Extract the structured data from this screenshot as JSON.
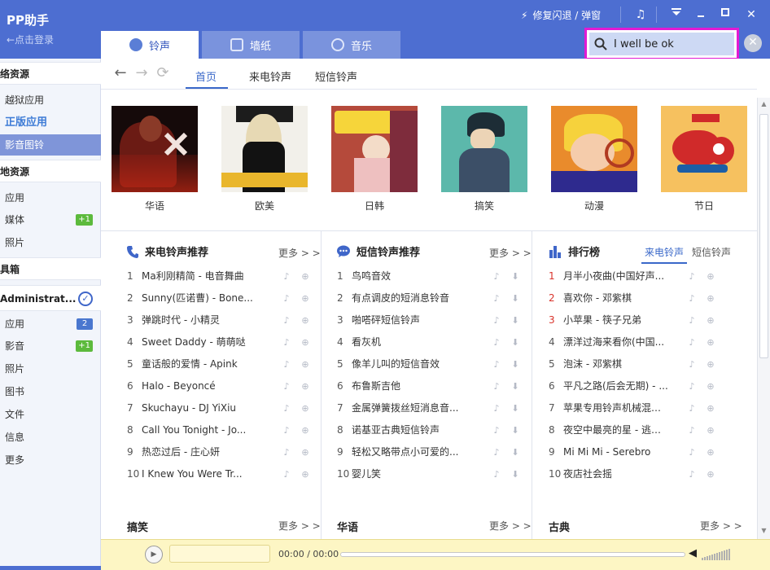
{
  "app": {
    "title": "PP助手",
    "login": "←点击登录",
    "repair": "修复闪退 / 弹窗"
  },
  "main_tabs": [
    {
      "label": "铃声",
      "active": true
    },
    {
      "label": "墙纸",
      "active": false
    },
    {
      "label": "音乐",
      "active": false
    }
  ],
  "search": {
    "value": "I well be ok"
  },
  "sidebar": {
    "groups": [
      {
        "label": "络资源"
      },
      {
        "label": "地资源"
      },
      {
        "label": "具箱"
      },
      {
        "label": "Administrat..."
      }
    ],
    "items": [
      {
        "label": "越狱应用"
      },
      {
        "label": "正版应用"
      },
      {
        "label": "影音图铃"
      },
      {
        "label": "应用"
      },
      {
        "label": "媒体",
        "badge": "+1"
      },
      {
        "label": "照片"
      },
      {
        "label": "应用",
        "badge": "2"
      },
      {
        "label": "影音",
        "badge": "+1"
      },
      {
        "label": "照片"
      },
      {
        "label": "图书"
      },
      {
        "label": "文件"
      },
      {
        "label": "信息"
      },
      {
        "label": "更多"
      }
    ]
  },
  "sub_tabs": [
    {
      "label": "首页",
      "active": true
    },
    {
      "label": "来电铃声",
      "active": false
    },
    {
      "label": "短信铃声",
      "active": false
    }
  ],
  "categories": [
    {
      "label": "华语"
    },
    {
      "label": "欧美"
    },
    {
      "label": "日韩"
    },
    {
      "label": "搞笑"
    },
    {
      "label": "动漫"
    },
    {
      "label": "节日"
    }
  ],
  "panels": [
    {
      "title": "来电铃声推荐",
      "more": "更多 > >",
      "items": [
        {
          "num": "1",
          "text": "Ma利刚精简 - 电音舞曲"
        },
        {
          "num": "2",
          "text": "Sunny(匹诺曹) - Bone..."
        },
        {
          "num": "3",
          "text": "弹跳时代 - 小精灵"
        },
        {
          "num": "4",
          "text": "Sweet Daddy - 萌萌哒"
        },
        {
          "num": "5",
          "text": "童话般的爱情 - Apink"
        },
        {
          "num": "6",
          "text": "Halo - Beyoncé"
        },
        {
          "num": "7",
          "text": "Skuchayu - DJ YiXiu"
        },
        {
          "num": "8",
          "text": "Call You Tonight - Jo..."
        },
        {
          "num": "9",
          "text": "热恋过后 - 庄心妍"
        },
        {
          "num": "10",
          "text": "I Knew You Were Tr..."
        }
      ]
    },
    {
      "title": "短信铃声推荐",
      "more": "更多 > >",
      "items": [
        {
          "num": "1",
          "text": "鸟鸣音效"
        },
        {
          "num": "2",
          "text": "有点调皮的短消息铃音"
        },
        {
          "num": "3",
          "text": "啪嗒砰短信铃声"
        },
        {
          "num": "4",
          "text": "看灰机"
        },
        {
          "num": "5",
          "text": "像羊儿叫的短信音效"
        },
        {
          "num": "6",
          "text": "布鲁斯吉他"
        },
        {
          "num": "7",
          "text": "金属弹簧拨丝短消息音..."
        },
        {
          "num": "8",
          "text": "诺基亚古典短信铃声"
        },
        {
          "num": "9",
          "text": "轻松又略带点小可爱的..."
        },
        {
          "num": "10",
          "text": "婴儿笑"
        }
      ]
    },
    {
      "title": "排行榜",
      "tabs": [
        "来电铃声",
        "短信铃声"
      ],
      "items": [
        {
          "num": "1",
          "text": "月半小夜曲(中国好声..."
        },
        {
          "num": "2",
          "text": "喜欢你 - 邓紫棋"
        },
        {
          "num": "3",
          "text": "小苹果 - 筷子兄弟"
        },
        {
          "num": "4",
          "text": "漂洋过海来看你(中国..."
        },
        {
          "num": "5",
          "text": "泡沫 - 邓紫棋"
        },
        {
          "num": "6",
          "text": "平凡之路(后会无期) - ..."
        },
        {
          "num": "7",
          "text": "苹果专用铃声机械混音..."
        },
        {
          "num": "8",
          "text": "夜空中最亮的星 - 逃跑..."
        },
        {
          "num": "9",
          "text": "Mi Mi Mi - Serebro"
        },
        {
          "num": "10",
          "text": "夜店社会摇"
        }
      ]
    }
  ],
  "bottom_sections": [
    {
      "title": "搞笑",
      "more": "更多 > >"
    },
    {
      "title": "华语",
      "more": "更多 > >"
    },
    {
      "title": "古典",
      "more": "更多 > >"
    }
  ],
  "player": {
    "time": "00:00 / 00:00"
  },
  "colors": {
    "brand_blue": "#4d6ed1",
    "search_highlight": "#e21ad4",
    "accent_link": "#3a68c9",
    "rank_red": "#d9332b",
    "badge_green": "#5cba3c"
  }
}
